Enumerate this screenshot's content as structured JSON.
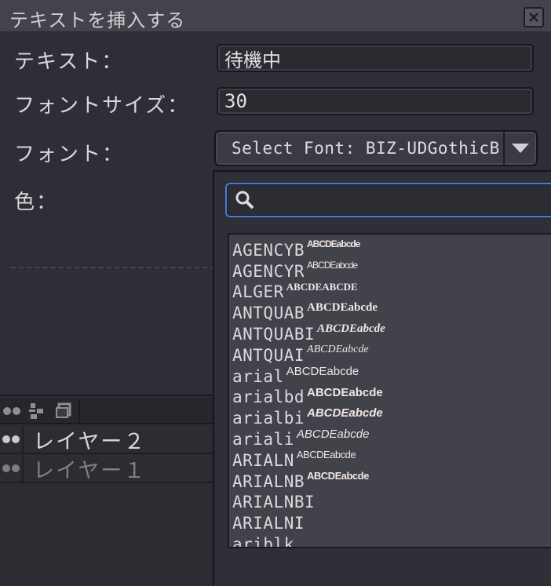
{
  "dialog": {
    "title": "テキストを挿入する",
    "text_label": "テキスト：",
    "text_value": "待機中",
    "font_size_label": "フォントサイズ：",
    "font_size_value": "30",
    "font_label": "フォント：",
    "font_select_value": "Select Font: BIZ-UDGothicB",
    "color_label": "色："
  },
  "font_dropdown": {
    "search_value": "",
    "fonts": [
      {
        "name": "AGENCYB",
        "preview": "ABCDEabcde"
      },
      {
        "name": "AGENCYR",
        "preview": "ABCDEabcde"
      },
      {
        "name": "ALGER",
        "preview": "ABCDEABCDE"
      },
      {
        "name": "ANTQUAB",
        "preview": "ABCDEabcde"
      },
      {
        "name": "ANTQUABI",
        "preview": "ABCDEabcde"
      },
      {
        "name": "ANTQUAI",
        "preview": "ABCDEabcde"
      },
      {
        "name": "arial",
        "preview": "ABCDEabcde"
      },
      {
        "name": "arialbd",
        "preview": "ABCDEabcde"
      },
      {
        "name": "arialbi",
        "preview": "ABCDEabcde"
      },
      {
        "name": "ariali",
        "preview": "ABCDEabcde"
      },
      {
        "name": "ARIALN",
        "preview": "ABCDEabcde"
      },
      {
        "name": "ARIALNB",
        "preview": "ABCDEabcde"
      },
      {
        "name": "ARIALNBI",
        "preview": ""
      },
      {
        "name": "ARIALNI",
        "preview": ""
      },
      {
        "name": "ariblk",
        "preview": ""
      }
    ]
  },
  "layers": {
    "items": [
      {
        "name": "レイヤー２",
        "active": true
      },
      {
        "name": "レイヤー１",
        "active": false
      }
    ]
  },
  "colors": {
    "accent": "#4a79d8",
    "panel": "#2e2f36",
    "titlebar": "#43444b"
  }
}
